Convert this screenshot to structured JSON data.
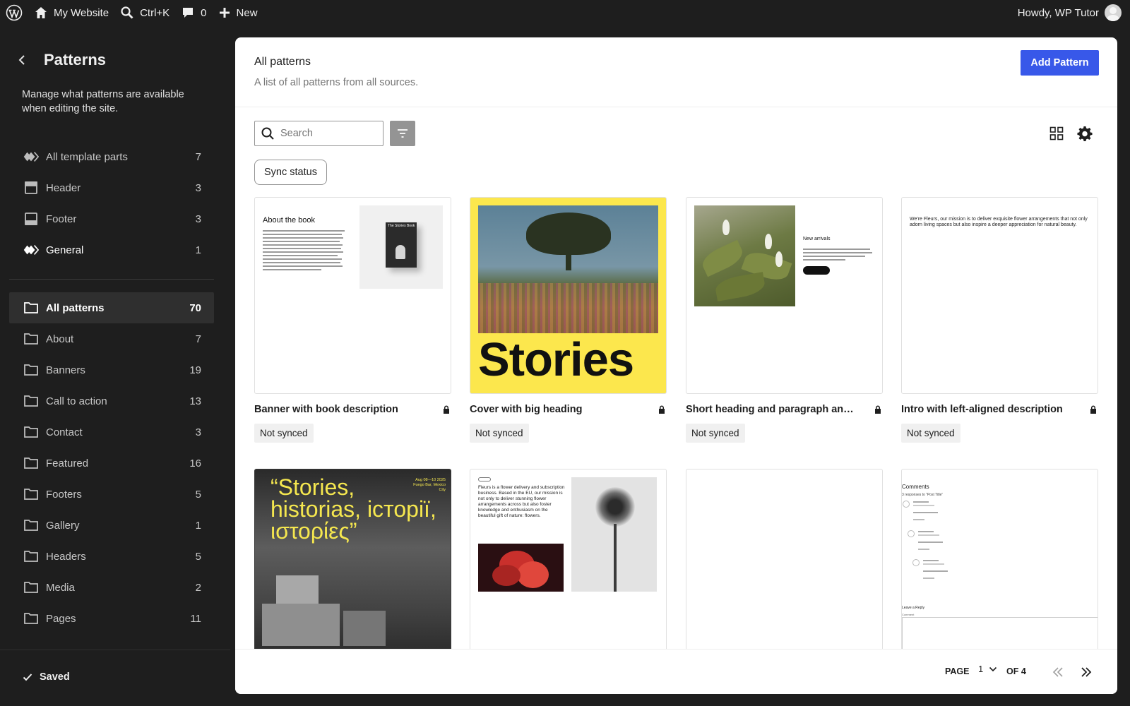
{
  "admin_bar": {
    "site_name": "My Website",
    "search_shortcut": "Ctrl+K",
    "comments_count": "0",
    "new_label": "New",
    "greeting": "Howdy, WP Tutor"
  },
  "sidebar": {
    "title": "Patterns",
    "description": "Manage what patterns are available when editing the site.",
    "template_parts": [
      {
        "label": "All template parts",
        "count": "7",
        "icon": "template-parts-icon"
      },
      {
        "label": "Header",
        "count": "3",
        "icon": "header-icon"
      },
      {
        "label": "Footer",
        "count": "3",
        "icon": "footer-icon"
      },
      {
        "label": "General",
        "count": "1",
        "icon": "general-icon"
      }
    ],
    "categories": [
      {
        "label": "All patterns",
        "count": "70"
      },
      {
        "label": "About",
        "count": "7"
      },
      {
        "label": "Banners",
        "count": "19"
      },
      {
        "label": "Call to action",
        "count": "13"
      },
      {
        "label": "Contact",
        "count": "3"
      },
      {
        "label": "Featured",
        "count": "16"
      },
      {
        "label": "Footers",
        "count": "5"
      },
      {
        "label": "Gallery",
        "count": "1"
      },
      {
        "label": "Headers",
        "count": "5"
      },
      {
        "label": "Media",
        "count": "2"
      },
      {
        "label": "Pages",
        "count": "11"
      }
    ],
    "saved_label": "Saved"
  },
  "main": {
    "title": "All patterns",
    "subtitle": "A list of all patterns from all sources.",
    "add_button": "Add Pattern",
    "search_placeholder": "Search",
    "sync_filter": "Sync status",
    "cards": [
      {
        "title": "Banner with book description",
        "badge": "Not synced"
      },
      {
        "title": "Cover with big heading",
        "badge": "Not synced"
      },
      {
        "title": "Short heading and paragraph and image on the left",
        "badge": "Not synced"
      },
      {
        "title": "Intro with left-aligned description",
        "badge": "Not synced"
      }
    ],
    "thumbs": {
      "book_heading": "About the book",
      "book_cover_text": "The Stories Book",
      "cover_heading": "Stories",
      "arrivals_heading": "New arrivals",
      "intro_text": "We're Fleurs, our mission is to deliver exquisite flower arrangements that not only adorn living spaces but also inspire a deeper appreciation for natural beauty.",
      "quote_text": "“Stories, historias, історії, ιστορίες”",
      "quote_date": "Aug 08—10 2025 Fuego Bar, Mexico City",
      "fleurs_text": "Fleurs is a flower delivery and subscription business. Based in the EU, our mission is not only to deliver stunning flower arrangements across but also foster knowledge and enthusiasm on the beautiful gift of nature: flowers.",
      "comments_heading": "Comments",
      "comments_sub": "3 responses to “Post Title”",
      "reply_heading": "Leave a Reply",
      "comment_label": "Comment"
    },
    "pagination": {
      "page_label": "PAGE",
      "current_page": "1",
      "of_label": "OF 4"
    }
  }
}
